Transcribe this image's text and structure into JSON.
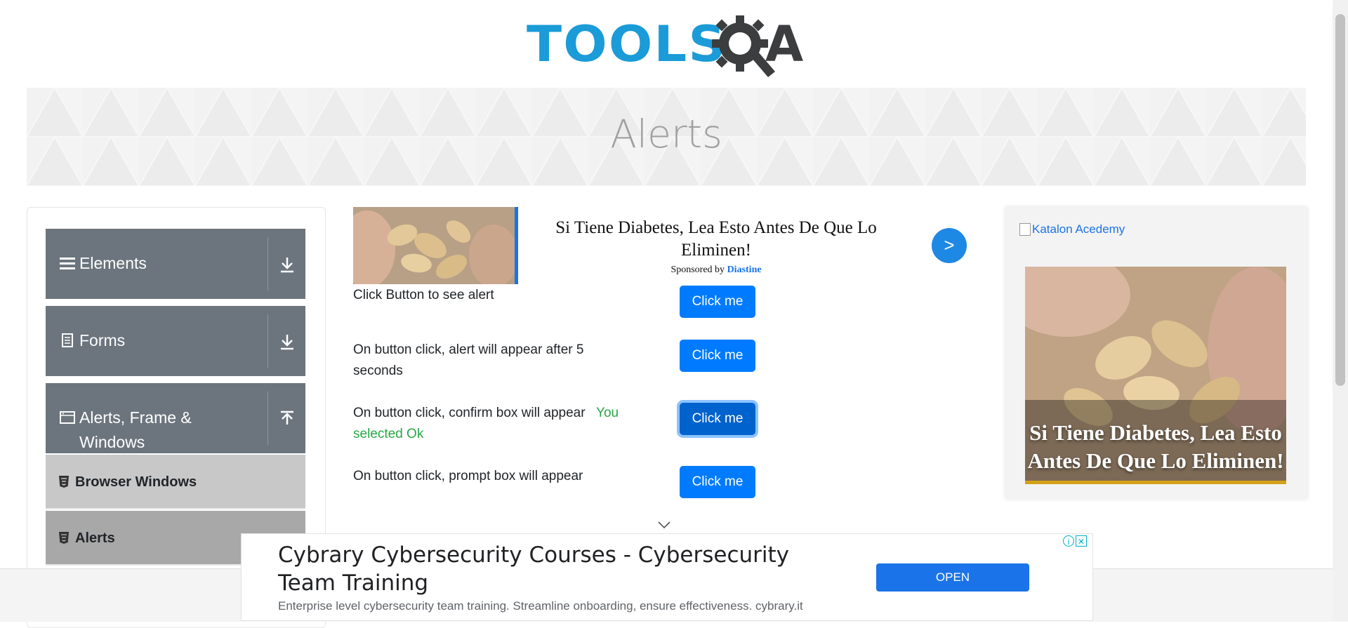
{
  "header": {
    "logo_text_left": "TOOLS",
    "logo_text_right": "A"
  },
  "banner": {
    "title": "Alerts"
  },
  "sidebar": {
    "groups": [
      {
        "label": "Elements",
        "icon": "menu-icon",
        "arrow": "download-arrow-icon"
      },
      {
        "label": "Forms",
        "icon": "form-icon",
        "arrow": "download-arrow-icon"
      },
      {
        "label": "Alerts, Frame & Windows",
        "icon": "window-icon",
        "arrow": "upload-arrow-icon"
      }
    ],
    "items": [
      {
        "label": "Browser Windows",
        "icon": "html5-icon"
      },
      {
        "label": "Alerts",
        "icon": "html5-icon"
      }
    ]
  },
  "top_ad": {
    "headline": "Si Tiene Diabetes, Lea Esto Antes De Que Lo Eliminen!",
    "sponsored_prefix": "Sponsored by",
    "sponsor": "Diastine",
    "go_label": ">"
  },
  "alerts": {
    "rows": [
      {
        "text": "Click Button to see alert",
        "button": "Click me"
      },
      {
        "text": "On button click, alert will appear after 5 seconds",
        "button": "Click me"
      },
      {
        "text": "On button click, confirm box will appear",
        "result": "You selected Ok",
        "button": "Click me"
      },
      {
        "text": "On button click, prompt box will appear",
        "button": "Click me"
      }
    ]
  },
  "right_ad": {
    "alt_text": "Katalon Acedemy",
    "caption": "Si Tiene Diabetes, Lea Esto Antes De Que Lo Eliminen!"
  },
  "bottom_ad": {
    "title": "Cybrary Cybersecurity Courses - Cybersecurity Team Training",
    "description": "Enterprise level cybersecurity team training. Streamline onboarding, ensure effectiveness. cybrary.it",
    "open_label": "OPEN",
    "info_glyph": "i",
    "close_glyph": "✕"
  },
  "colors": {
    "accent": "#007bff",
    "nav_gray": "#6c757d",
    "ok_green": "#28a745",
    "logo_blue": "#1b9bd7"
  }
}
